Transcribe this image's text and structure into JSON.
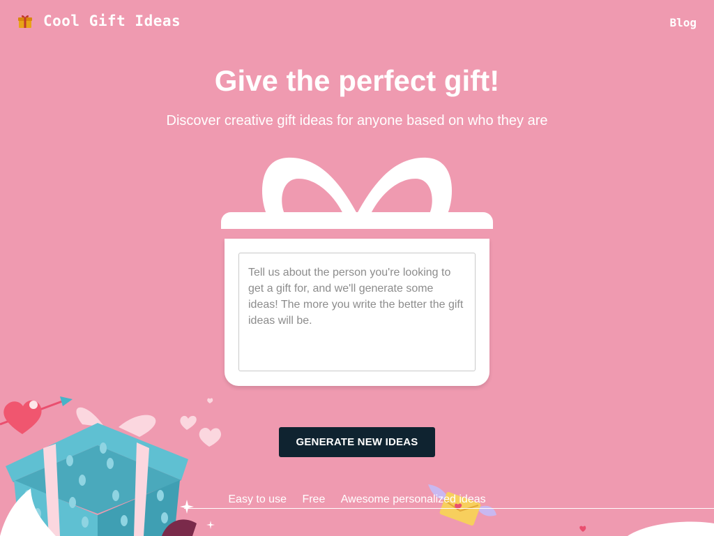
{
  "header": {
    "brand_text": "Cool Gift Ideas",
    "brand_icon": "gift-icon",
    "blog_label": "Blog"
  },
  "hero": {
    "title": "Give the perfect gift!",
    "subtitle": "Discover creative gift ideas for anyone based on who they are"
  },
  "form": {
    "input_value": "",
    "input_placeholder": "Tell us about the person you're looking to get a gift for, and we'll generate some ideas! The more you write the better the gift ideas will be.",
    "generate_label": "GENERATE NEW IDEAS"
  },
  "features": [
    "Easy to use",
    "Free",
    "Awesome personalized ideas"
  ],
  "colors": {
    "background": "#ef9ab0",
    "button": "#0f2330",
    "text": "#ffffff",
    "gift_blue": "#5fc0d2",
    "heart_red": "#f0566f"
  }
}
